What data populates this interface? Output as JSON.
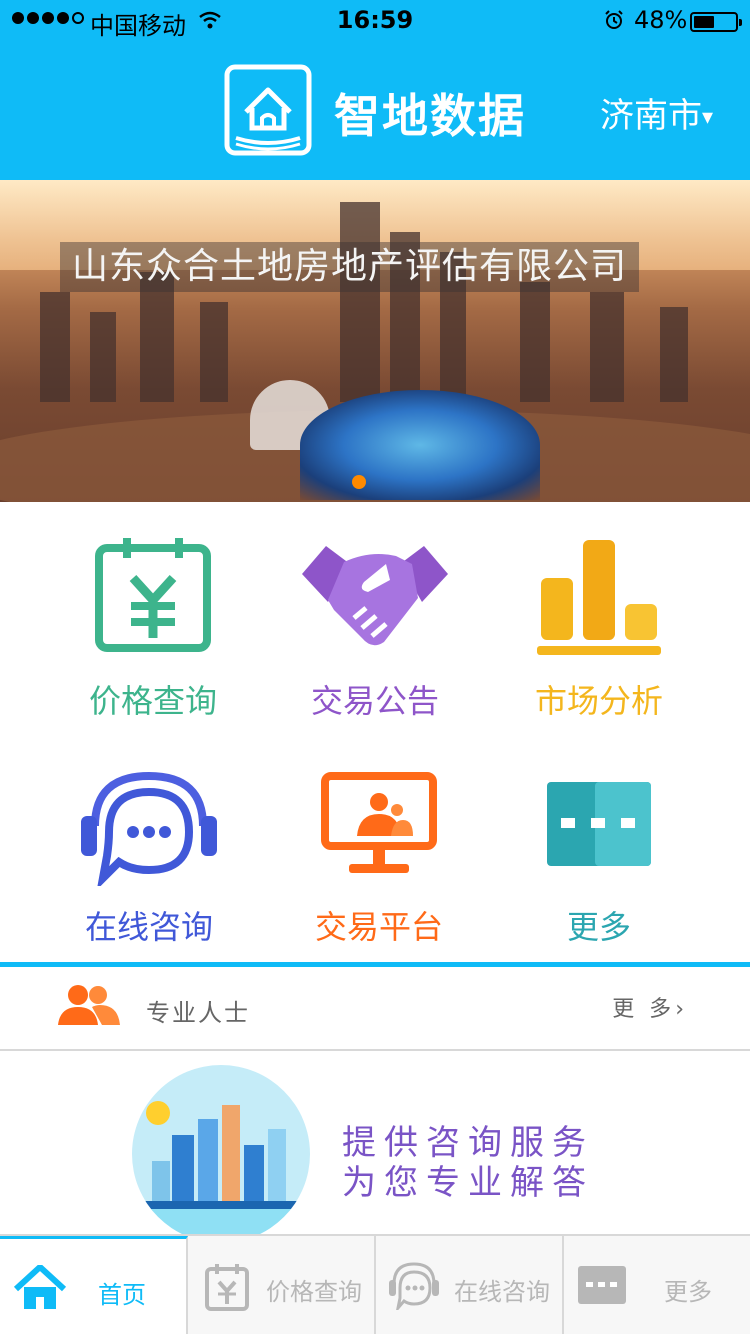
{
  "status_bar": {
    "carrier": "中国移动",
    "time": "16:59",
    "battery": "48%",
    "battery_level": 0.48
  },
  "header": {
    "title": "智地数据",
    "city": "济南市",
    "city_caret": "▾",
    "logo_icon": "house-book-icon"
  },
  "banner": {
    "caption": "山东众合土地房地产评估有限公司",
    "page_indicator": {
      "count": 1,
      "active": 0
    },
    "accent": "#ff8a00"
  },
  "menu": [
    {
      "label": "价格查询",
      "icon": "price-calendar-icon",
      "color": "#3db48c"
    },
    {
      "label": "交易公告",
      "icon": "handshake-icon",
      "color": "#8e55c9"
    },
    {
      "label": "市场分析",
      "icon": "bar-chart-icon",
      "color": "#f4b61d"
    },
    {
      "label": "在线咨询",
      "icon": "headset-chat-icon",
      "color": "#4058d8"
    },
    {
      "label": "交易平台",
      "icon": "monitor-person-icon",
      "color": "#ff6a18"
    },
    {
      "label": "更多",
      "icon": "more-dots-icon",
      "color": "#2ba6b0"
    }
  ],
  "professionals": {
    "title": "专业人士",
    "more": "更 多",
    "more_chevron": "›",
    "icon": "people-icon"
  },
  "promo": {
    "line1": "提供咨询服务",
    "line2": "为您专业解答",
    "image_icon": "city-skyline-icon"
  },
  "tabbar": [
    {
      "label": "首页",
      "icon": "home-icon",
      "active": true
    },
    {
      "label": "价格查询",
      "icon": "price-calendar-icon",
      "active": false
    },
    {
      "label": "在线咨询",
      "icon": "chat-bubble-icon",
      "active": false
    },
    {
      "label": "更多",
      "icon": "more-dots-icon",
      "active": false
    }
  ],
  "colors": {
    "primary": "#0fbbf7",
    "tab_inactive": "#b7b7b7"
  }
}
